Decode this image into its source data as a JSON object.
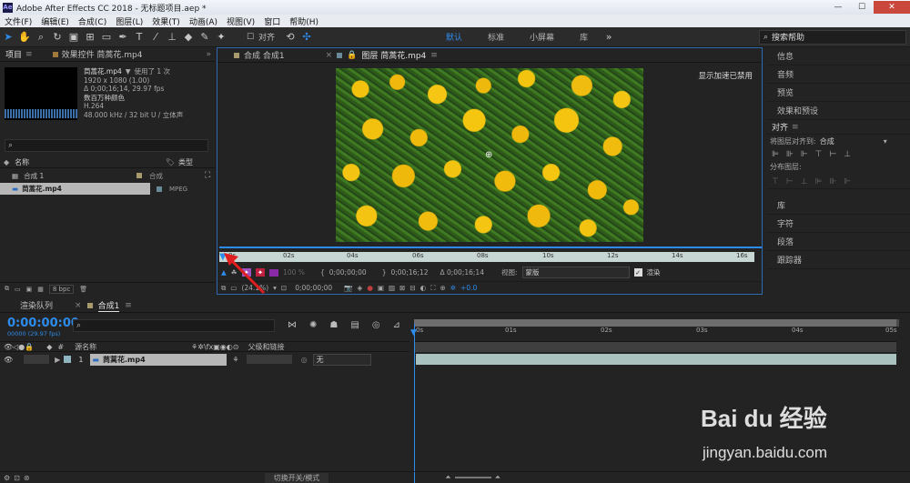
{
  "titlebar": {
    "app_icon": "Ae",
    "title": "Adobe After Effects CC 2018 - 无标题项目.aep *",
    "minimize": "—",
    "maximize": "☐",
    "close": "✕"
  },
  "menu": [
    "文件(F)",
    "编辑(E)",
    "合成(C)",
    "图层(L)",
    "效果(T)",
    "动画(A)",
    "视图(V)",
    "窗口",
    "帮助(H)"
  ],
  "toolbar": {
    "align_label": "对齐",
    "workspaces": [
      "默认",
      "标准",
      "小屏幕",
      "库"
    ],
    "search_placeholder": "搜索帮助"
  },
  "project": {
    "tab": "项目",
    "effects_tab": "效果控件 茼蒿花.mp4",
    "file": {
      "name": "茼蒿花.mp4",
      "used": "使用了 1 次",
      "res": "1920 x 1080 (1.00)",
      "duration": "Δ 0;00;16;14, 29.97 fps",
      "colors": "数百万种颜色",
      "codec": "H.264",
      "audio": "48.000 kHz / 32 bit U / 立体声"
    },
    "search_placeholder": "",
    "col_name": "名称",
    "col_type": "类型",
    "items": [
      {
        "name": "合成 1",
        "type": "合成"
      },
      {
        "name": "茼蒿花.mp4",
        "type": "MPEG"
      }
    ],
    "bpc": "8 bpc"
  },
  "viewer": {
    "tab_comp": "合成 合成1",
    "tab_layer": "图层 茼蒿花.mp4",
    "accel": "显示加速已禁用",
    "ticks": [
      "0s",
      "02s",
      "04s",
      "06s",
      "08s",
      "10s",
      "12s",
      "14s",
      "16s"
    ],
    "zoom": "100 %",
    "in_tc": "0;00;00;00",
    "out_tc": "0;00;16;12",
    "dur_tc": "Δ 0;00;16;14",
    "view_label": "视图:",
    "view_value": "蒙版",
    "render_label": "渲染",
    "bottom_zoom": "(24.1%)",
    "bottom_tc": "0;00;00;00",
    "offset": "+0.0"
  },
  "right": {
    "items": [
      "信息",
      "音频",
      "预览",
      "效果和预设"
    ],
    "align_title": "对齐",
    "align_to_label": "将图层对齐到:",
    "align_to_value": "合成",
    "distribute": "分布图层:",
    "items2": [
      "库",
      "字符",
      "段落",
      "跟踪器"
    ]
  },
  "timeline": {
    "tab_render": "渲染队列",
    "tab_comp": "合成1",
    "timecode": "0:00:00:00",
    "fps": "00000 (29.97 fps)",
    "col_source": "源名称",
    "col_parent": "父级和链接",
    "layer": {
      "num": "1",
      "name": "茼蒿花.mp4",
      "parent": "无"
    },
    "ticks": [
      "0s",
      "01s",
      "02s",
      "03s",
      "04s",
      "05s"
    ],
    "footer": "切换开关/模式"
  },
  "watermark": {
    "brand": "Bai du 经验",
    "url": "jingyan.baidu.com"
  }
}
